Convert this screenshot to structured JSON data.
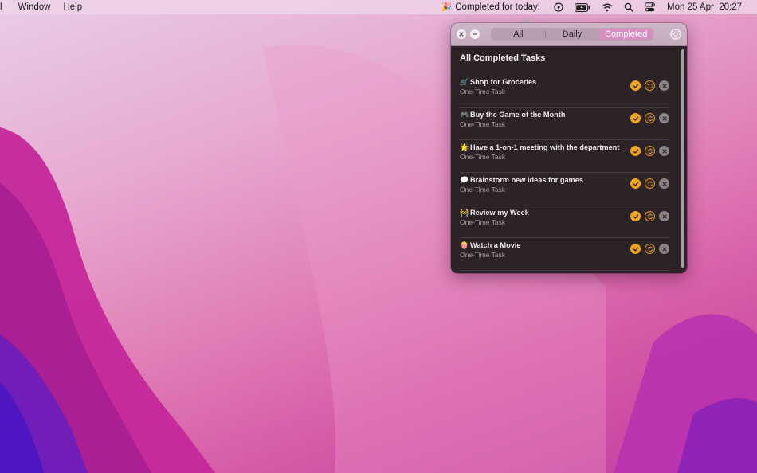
{
  "menubar": {
    "left_items": [
      "l",
      "Window",
      "Help"
    ],
    "status_text": "Completed for today!",
    "status_emoji": "🎉",
    "clock": "Mon 25 Apr  20:27",
    "icons": [
      "play-circle-icon",
      "battery-icon",
      "wifi-icon",
      "spotlight-search-icon",
      "control-center-icon"
    ]
  },
  "popover": {
    "tabs": [
      {
        "label": "All",
        "active": false
      },
      {
        "label": "Daily",
        "active": false
      },
      {
        "label": "Completed",
        "active": true
      }
    ],
    "section_title": "All Completed Tasks",
    "tasks": [
      {
        "emoji": "🛒",
        "title": "Shop for Groceries",
        "type": "One-Time Task"
      },
      {
        "emoji": "🎮",
        "title": "Buy the Game of the Month",
        "type": "One-Time Task"
      },
      {
        "emoji": "🌟",
        "title": "Have a 1-on-1 meeting with the department",
        "type": "One-Time Task"
      },
      {
        "emoji": "💭",
        "title": "Brainstorm new ideas for games",
        "type": "One-Time Task"
      },
      {
        "emoji": "🚧",
        "title": "Review my Week",
        "type": "One-Time Task"
      },
      {
        "emoji": "🍿",
        "title": "Watch a Movie",
        "type": "One-Time Task"
      }
    ]
  },
  "colors": {
    "accent": "#d78ec0",
    "check": "#f0a41f",
    "panel": "#2c2327"
  }
}
